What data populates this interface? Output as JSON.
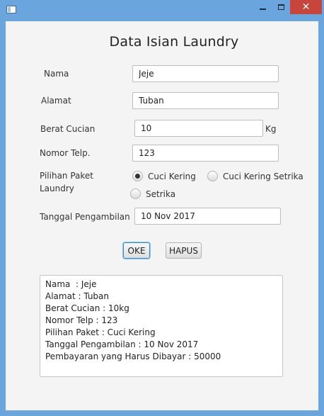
{
  "window": {
    "minimize_icon": "minimize-icon",
    "maximize_icon": "maximize-icon",
    "close_icon": "close-icon",
    "close_glyph": "✕"
  },
  "form": {
    "title": "Data Isian Laundry",
    "nama_label": "Nama",
    "nama_value": "Jeje",
    "alamat_label": "Alamat",
    "alamat_value": "Tuban",
    "berat_label": "Berat Cucian",
    "berat_value": "10",
    "berat_unit": "Kg",
    "telp_label": "Nomor Telp.",
    "telp_value": "123",
    "paket_label_line1": "Pilihan Paket",
    "paket_label_line2": "Laundry",
    "paket_options": [
      "Cuci Kering",
      "Cuci Kering Setrika",
      "Setrika"
    ],
    "paket_selected": "Cuci Kering",
    "tanggal_label": "Tanggal Pengambilan",
    "tanggal_value": "10 Nov 2017"
  },
  "buttons": {
    "ok_label": "OKE",
    "hapus_label": "HAPUS"
  },
  "output": {
    "lines": [
      "Nama  : Jeje",
      "Alamat : Tuban",
      "Berat Cucian : 10kg",
      "Nomor Telp : 123",
      "Pilihan Paket : Cuci Kering",
      "Tanggal Pengambilan : 10 Nov 2017",
      "Pembayaran yang Harus Dibayar : 50000"
    ]
  }
}
